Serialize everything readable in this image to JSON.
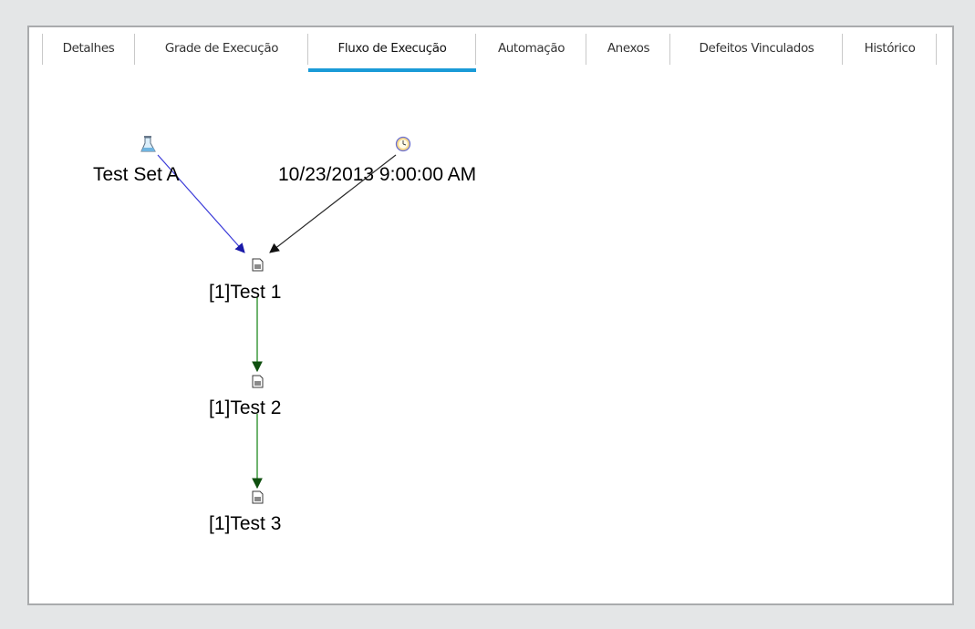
{
  "tabs": [
    {
      "label": "Detalhes",
      "active": false
    },
    {
      "label": "Grade de Execução",
      "active": false
    },
    {
      "label": "Fluxo de Execução",
      "active": true
    },
    {
      "label": "Automação",
      "active": false
    },
    {
      "label": "Anexos",
      "active": false
    },
    {
      "label": "Defeitos Vinculados",
      "active": false
    },
    {
      "label": "Histórico",
      "active": false
    }
  ],
  "flow": {
    "test_set_label": "Test Set A",
    "time_dependency_label": "10/23/2013 9:00:00 AM",
    "tests": [
      {
        "label": "[1]Test 1"
      },
      {
        "label": "[1]Test 2"
      },
      {
        "label": "[1]Test 3"
      }
    ],
    "icons": {
      "test_set": "test-set-flask-icon",
      "time": "clock-icon",
      "test": "test-document-icon"
    }
  },
  "colors": {
    "tab_active_underline": "#1a9bd7",
    "test_set_link": "#3a3ad8",
    "time_link": "#2a2a2a",
    "sequence_link": "#1f8a1f"
  }
}
